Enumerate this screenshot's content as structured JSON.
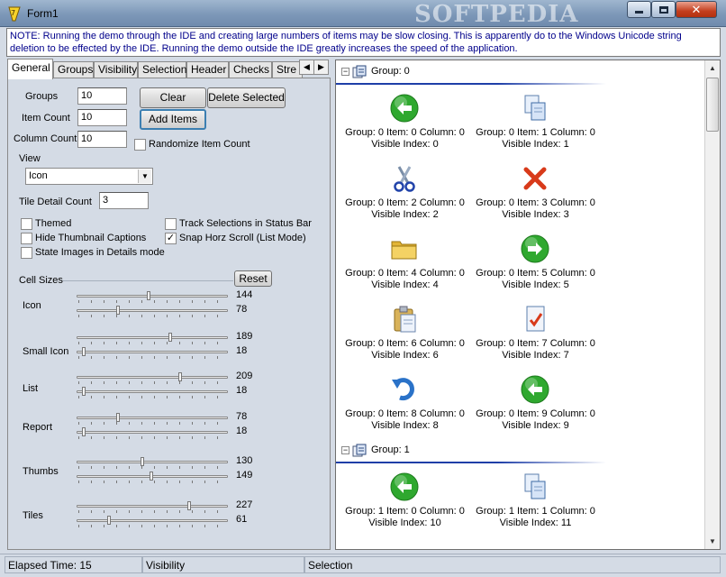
{
  "window": {
    "title": "Form1",
    "watermark": "SOFTPEDIA"
  },
  "note": "NOTE:  Running the demo through the IDE and creating large numbers of items may be slow closing.  This is apparently do to the Windows Unicode string deletion to be effected by the IDE.  Running the demo outside the IDE greatly increases the speed of the application.",
  "tabs": [
    "General",
    "Groups",
    "Visibility",
    "Selection",
    "Header",
    "Checks",
    "Stre"
  ],
  "general": {
    "groups_label": "Groups",
    "groups_value": "10",
    "item_count_label": "Item Count",
    "item_count_value": "10",
    "column_count_label": "Column Count",
    "column_count_value": "10",
    "clear_button": "Clear",
    "delete_selected_button": "Delete Selected",
    "add_items_button": "Add Items",
    "randomize_label": "Randomize Item Count",
    "view_label": "View",
    "view_value": "Icon",
    "tile_detail_label": "Tile Detail Count",
    "tile_detail_value": "3",
    "themed_label": "Themed",
    "track_selections_label": "Track Selections in Status Bar",
    "hide_thumbnail_label": "Hide Thumbnail Captions",
    "snap_horz_label": "Snap Horz Scroll (List Mode)",
    "snap_horz_checked": "✓",
    "state_images_label": "State Images in Details mode",
    "cell_sizes_label": "Cell Sizes",
    "reset_button": "Reset"
  },
  "cell_sizes": [
    {
      "label": "Icon",
      "width": "144",
      "height": "78",
      "w_frac": 0.48,
      "h_frac": 0.27
    },
    {
      "label": "Small Icon",
      "width": "189",
      "height": "18",
      "w_frac": 0.63,
      "h_frac": 0.04
    },
    {
      "label": "List",
      "width": "209",
      "height": "18",
      "w_frac": 0.7,
      "h_frac": 0.04
    },
    {
      "label": "Report",
      "width": "78",
      "height": "18",
      "w_frac": 0.27,
      "h_frac": 0.04
    },
    {
      "label": "Thumbs",
      "width": "130",
      "height": "149",
      "w_frac": 0.44,
      "h_frac": 0.5
    },
    {
      "label": "Tiles",
      "width": "227",
      "height": "61",
      "w_frac": 0.76,
      "h_frac": 0.21
    }
  ],
  "listview": {
    "groups": [
      {
        "label": "Group: 0",
        "items": [
          {
            "line1": "Group: 0 Item: 0 Column: 0",
            "line2": "Visible Index: 0",
            "icon": "back-arrow-icon"
          },
          {
            "line1": "Group: 0 Item: 1 Column: 0",
            "line2": "Visible Index: 1",
            "icon": "copy-icon"
          },
          {
            "line1": "Group: 0 Item: 2 Column: 0",
            "line2": "Visible Index: 2",
            "icon": "cut-icon"
          },
          {
            "line1": "Group: 0 Item: 3 Column: 0",
            "line2": "Visible Index: 3",
            "icon": "delete-icon"
          },
          {
            "line1": "Group: 0 Item: 4 Column: 0",
            "line2": "Visible Index: 4",
            "icon": "folder-icon"
          },
          {
            "line1": "Group: 0 Item: 5 Column: 0",
            "line2": "Visible Index: 5",
            "icon": "forward-arrow-icon"
          },
          {
            "line1": "Group: 0 Item: 6 Column: 0",
            "line2": "Visible Index: 6",
            "icon": "paste-icon"
          },
          {
            "line1": "Group: 0 Item: 7 Column: 0",
            "line2": "Visible Index: 7",
            "icon": "document-check-icon"
          },
          {
            "line1": "Group: 0 Item: 8 Column: 0",
            "line2": "Visible Index: 8",
            "icon": "undo-icon"
          },
          {
            "line1": "Group: 0 Item: 9 Column: 0",
            "line2": "Visible Index: 9",
            "icon": "back-arrow-icon"
          }
        ]
      },
      {
        "label": "Group: 1",
        "items": [
          {
            "line1": "Group: 1 Item: 0 Column: 0",
            "line2": "Visible Index: 10",
            "icon": "back-arrow-icon"
          },
          {
            "line1": "Group: 1 Item: 1 Column: 0",
            "line2": "Visible Index: 11",
            "icon": "copy-icon"
          }
        ]
      }
    ]
  },
  "status": {
    "elapsed": "Elapsed Time: 15",
    "visibility": "Visibility",
    "selection": "Selection"
  },
  "colors": {
    "note_text": "#00008b",
    "group_rule": "#1f3fa8",
    "arrow_green": "#2fa82f",
    "delete_red": "#d83a1a"
  }
}
